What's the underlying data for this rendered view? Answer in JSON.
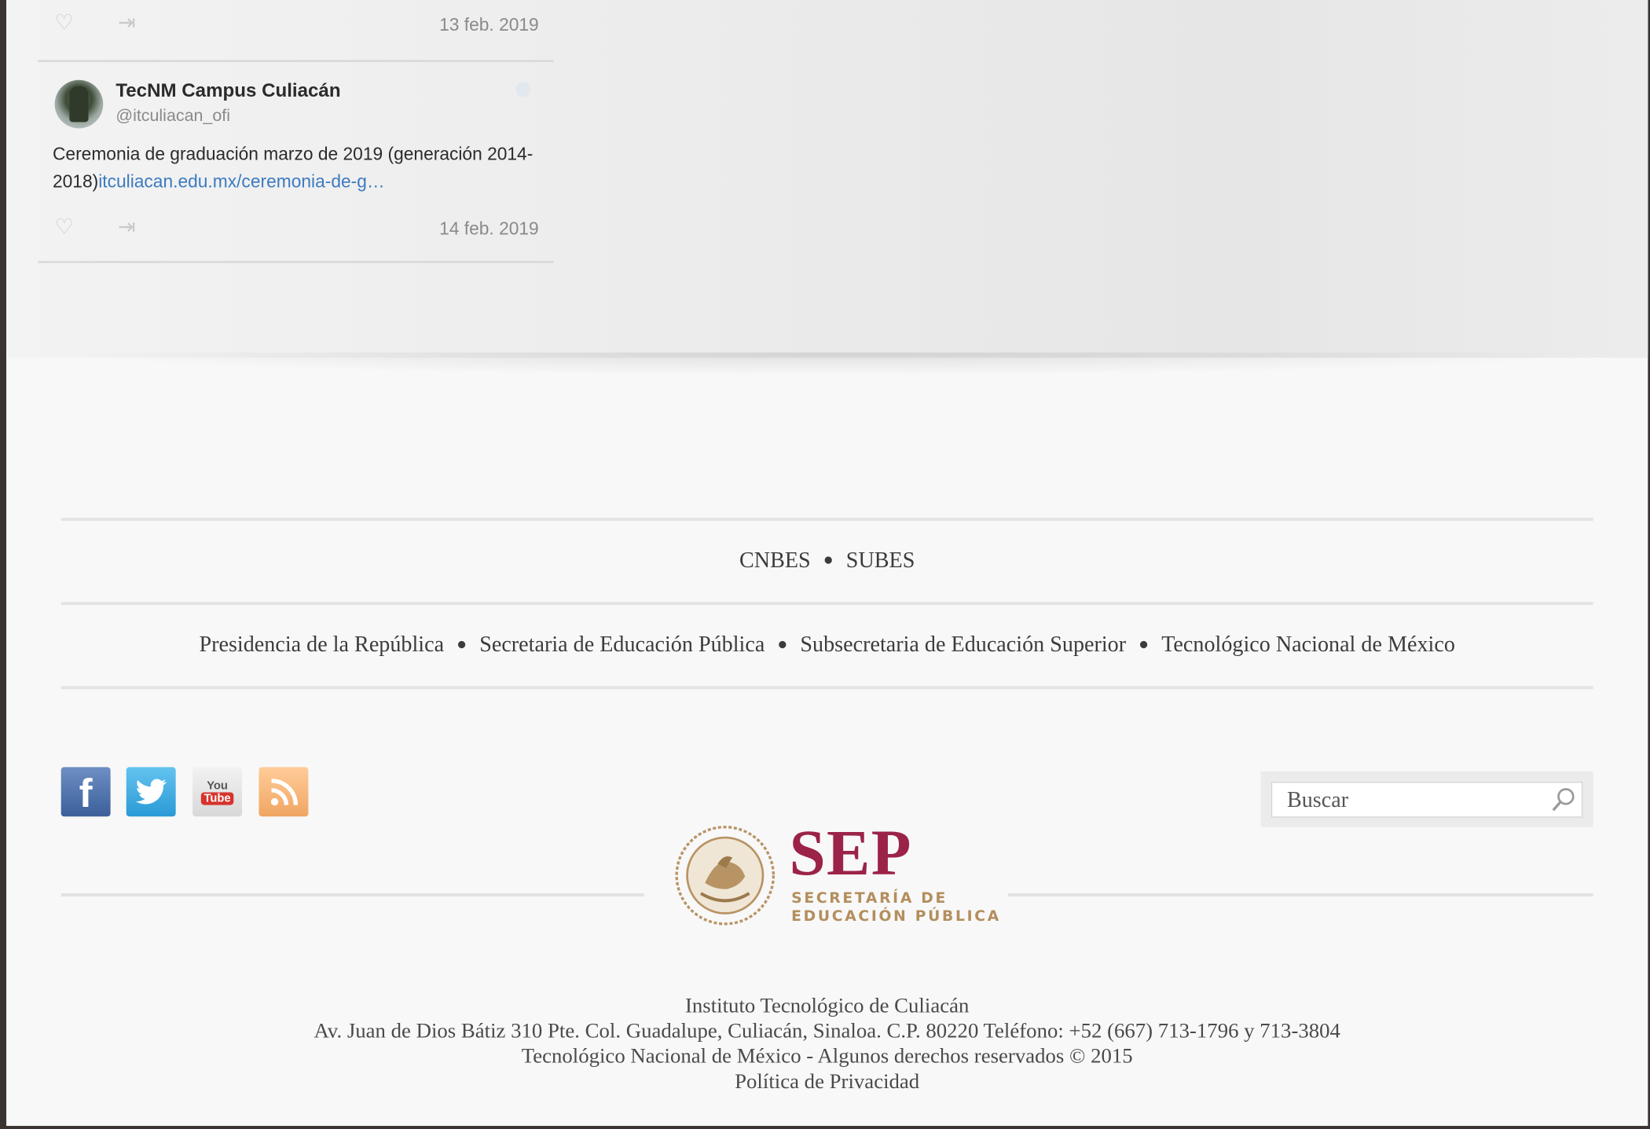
{
  "tweets": [
    {
      "date": "13 feb. 2019"
    },
    {
      "name": "TecNM Campus Culiacán",
      "handle": "@itculiacan_ofi",
      "text": "Ceremonia de graduación marzo de 2019 (generación 2014-2018)",
      "link": "itculiacan.edu.mx/ceremonia-de-g…",
      "date": "14 feb. 2019"
    }
  ],
  "footer": {
    "council_links": [
      "CNBES",
      "SUBES"
    ],
    "gov_links": [
      "Presidencia de la República",
      "Secretaria de Educación Pública",
      "Subsecretaria de Educación Superior",
      "Tecnológico Nacional de México"
    ],
    "social": [
      "facebook-icon",
      "twitter-icon",
      "youtube-icon",
      "rss-icon"
    ],
    "youtube_top": "You",
    "youtube_bottom": "Tube",
    "search": {
      "placeholder": "Buscar"
    },
    "sep": {
      "word": "SEP",
      "line1": "SECRETARÍA DE",
      "line2": "EDUCACIÓN PÚBLICA",
      "brand_color": "#9c2348",
      "gold_color": "#b38e5d"
    },
    "address": {
      "institution": "Instituto Tecnológico de Culiacán",
      "street": "Av. Juan de Dios Bátiz 310 Pte. Col. Guadalupe, Culiacán, Sinaloa. C.P. 80220 Teléfono: +52 (667) 713-1796 y 713-3804",
      "rights": "Tecnológico Nacional de México - Algunos derechos reservados © 2015",
      "privacy": "Política de Privacidad"
    }
  }
}
